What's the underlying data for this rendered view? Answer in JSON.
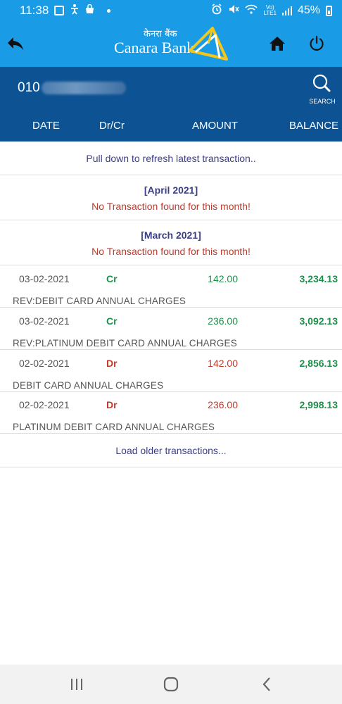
{
  "status_bar": {
    "time": "11:38",
    "network_label_top": "Vo)",
    "network_label_bottom": "LTE1",
    "battery_percent": "45%"
  },
  "header": {
    "logo_hindi": "केनरा बैंक",
    "logo_english": "Canara Bank"
  },
  "account": {
    "number_visible": "010",
    "search_label": "SEARCH"
  },
  "table_header": {
    "date": "DATE",
    "drcr": "Dr/Cr",
    "amount": "AMOUNT",
    "balance": "BALANCE"
  },
  "refresh_text": "Pull down to refresh latest transaction..",
  "months": [
    {
      "title": "[April 2021]",
      "message": "No Transaction found for this month!"
    },
    {
      "title": "[March 2021]",
      "message": "No Transaction found for this month!"
    }
  ],
  "transactions": [
    {
      "date": "03-02-2021",
      "type": "Cr",
      "amount": "142.00",
      "balance": "3,234.13",
      "description": "REV:DEBIT CARD ANNUAL CHARGES"
    },
    {
      "date": "03-02-2021",
      "type": "Cr",
      "amount": "236.00",
      "balance": "3,092.13",
      "description": "REV:PLATINUM DEBIT CARD ANNUAL CHARGES"
    },
    {
      "date": "02-02-2021",
      "type": "Dr",
      "amount": "142.00",
      "balance": "2,856.13",
      "description": "DEBIT CARD ANNUAL CHARGES"
    },
    {
      "date": "02-02-2021",
      "type": "Dr",
      "amount": "236.00",
      "balance": "2,998.13",
      "description": "PLATINUM DEBIT CARD ANNUAL CHARGES"
    }
  ],
  "load_older": "Load older transactions...",
  "icons": {
    "back": "back-arrow-icon",
    "home": "home-icon",
    "power": "power-icon",
    "search": "search-icon",
    "recents": "recent-apps-icon",
    "nav_home": "nav-home-icon",
    "nav_back": "nav-back-icon"
  },
  "colors": {
    "header_blue": "#1a9be6",
    "account_bar": "#0d5393",
    "credit_green": "#1e8f4a",
    "debit_red": "#c0392b",
    "link_purple": "#3a3f85",
    "logo_yellow": "#f5c518"
  }
}
